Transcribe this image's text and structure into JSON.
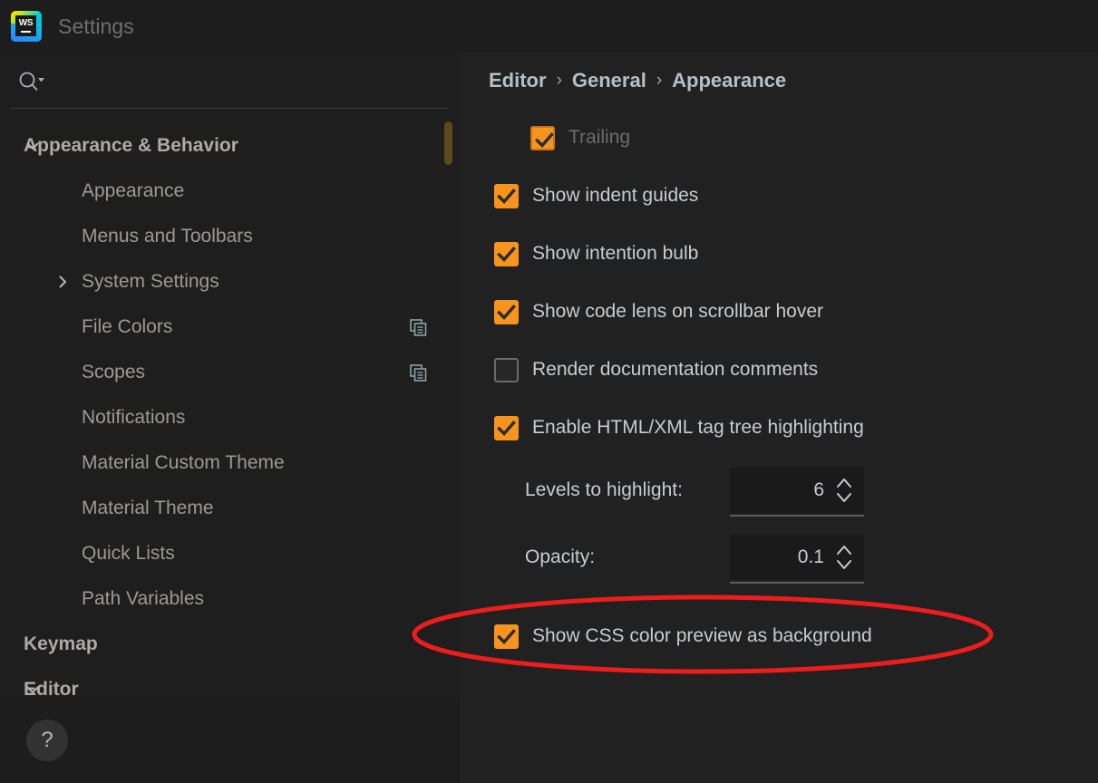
{
  "window": {
    "title": "Settings",
    "logo_name": "WS"
  },
  "search": {
    "icon": "search-icon",
    "value": "",
    "placeholder": ""
  },
  "sidebar": {
    "items": [
      {
        "label": "Appearance & Behavior",
        "level": 0,
        "bold": true,
        "twisty": "chevron-down",
        "copy": false
      },
      {
        "label": "Appearance",
        "level": 1,
        "bold": false,
        "twisty": "none",
        "copy": false
      },
      {
        "label": "Menus and Toolbars",
        "level": 1,
        "bold": false,
        "twisty": "none",
        "copy": false
      },
      {
        "label": "System Settings",
        "level": 1,
        "bold": false,
        "twisty": "chevron-right",
        "copy": false
      },
      {
        "label": "File Colors",
        "level": 1,
        "bold": false,
        "twisty": "none",
        "copy": true
      },
      {
        "label": "Scopes",
        "level": 1,
        "bold": false,
        "twisty": "none",
        "copy": true
      },
      {
        "label": "Notifications",
        "level": 1,
        "bold": false,
        "twisty": "none",
        "copy": false
      },
      {
        "label": "Material Custom Theme",
        "level": 1,
        "bold": false,
        "twisty": "none",
        "copy": false
      },
      {
        "label": "Material Theme",
        "level": 1,
        "bold": false,
        "twisty": "none",
        "copy": false
      },
      {
        "label": "Quick Lists",
        "level": 1,
        "bold": false,
        "twisty": "none",
        "copy": false
      },
      {
        "label": "Path Variables",
        "level": 1,
        "bold": false,
        "twisty": "none",
        "copy": false
      },
      {
        "label": "Keymap",
        "level": 0,
        "bold": true,
        "twisty": "none",
        "copy": false
      },
      {
        "label": "Editor",
        "level": 0,
        "bold": true,
        "twisty": "chevron-down",
        "copy": false
      }
    ],
    "scrollbar_color": "#5c4a1e"
  },
  "breadcrumb": {
    "separator": "›",
    "parts": [
      "Editor",
      "General",
      "Appearance"
    ]
  },
  "main": {
    "checkbox_rows": [
      {
        "label": "Trailing",
        "checked": true,
        "dim": true,
        "indent": 1,
        "focused": true
      },
      {
        "label": "Show indent guides",
        "checked": true,
        "dim": false,
        "indent": 0,
        "focused": false
      },
      {
        "label": "Show intention bulb",
        "checked": true,
        "dim": false,
        "indent": 0,
        "focused": false
      },
      {
        "label": "Show code lens on scrollbar hover",
        "checked": true,
        "dim": false,
        "indent": 0,
        "focused": false
      },
      {
        "label": "Render documentation comments",
        "checked": false,
        "dim": false,
        "indent": 0,
        "focused": false
      },
      {
        "label": "Enable HTML/XML tag tree highlighting",
        "checked": true,
        "dim": false,
        "indent": 0,
        "focused": false
      }
    ],
    "spinners": [
      {
        "label": "Levels to highlight:",
        "value": "6"
      },
      {
        "label": "Opacity:",
        "value": "0.1"
      }
    ],
    "highlighted_row": {
      "label": "Show CSS color preview as background",
      "checked": true
    }
  },
  "annotation": {
    "shape": "ellipse",
    "color": "#ee1d1d",
    "targets": "Show CSS color preview as background"
  },
  "help": {
    "label": "?"
  },
  "colors": {
    "accent_checkbox": "#f6941e",
    "breadcrumb_text": "#b3c0c8",
    "sidebar_bg": "#1e1e1e",
    "main_bg": "#212121",
    "titlebar_bg": "#1d1d1d",
    "annotation_red": "#ee1d1d"
  }
}
